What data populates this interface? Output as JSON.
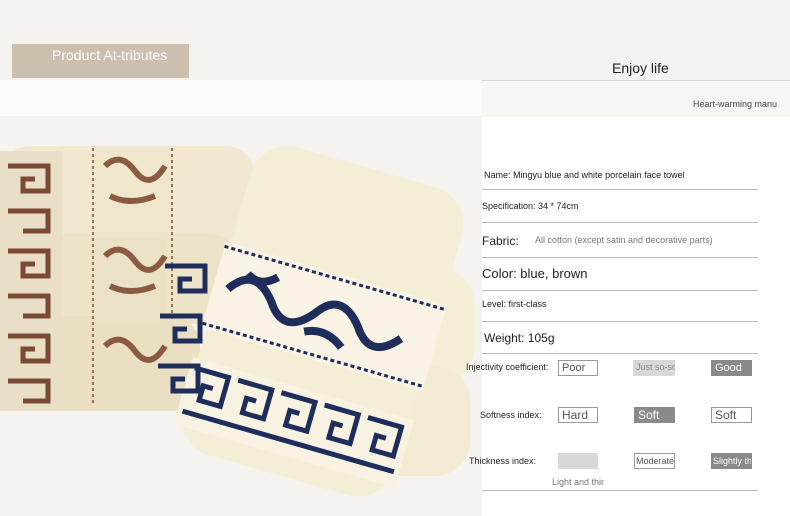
{
  "header": {
    "title": "Product At-tributes",
    "subtitle": "Enjoy life",
    "tagline": "Heart-warming manu"
  },
  "attributes": [
    {
      "label": "Name: Mingyu blue and white porcelain face towel"
    },
    {
      "label": "Specification: 34 * 74cm"
    },
    {
      "label": "Fabric:",
      "value": "All cotton (except satin and decorative parts)"
    },
    {
      "label": "Color: blue, brown"
    },
    {
      "label": "Level: first-class"
    },
    {
      "label": "Weight: 105g"
    }
  ],
  "scales": {
    "injectivity": {
      "label": "Injectivity coefficient:",
      "options": [
        "Poor",
        "Just so-so",
        "Good"
      ],
      "selected": "Good"
    },
    "softness": {
      "label": "Softness index:",
      "options": [
        "Hard",
        "Soft",
        "Soft"
      ],
      "selected": "Soft"
    },
    "thickness": {
      "label": "Thickness index:",
      "options": [
        "",
        "Moderate",
        "Slightly thicker"
      ],
      "selected": "Slightly thicker",
      "note": "Light and thir"
    }
  },
  "colors": {
    "accent": "#cdbfae",
    "blue_pattern": "#1f2d5c",
    "brown_pattern": "#7a4a35",
    "towel": "#f3ecd6"
  }
}
